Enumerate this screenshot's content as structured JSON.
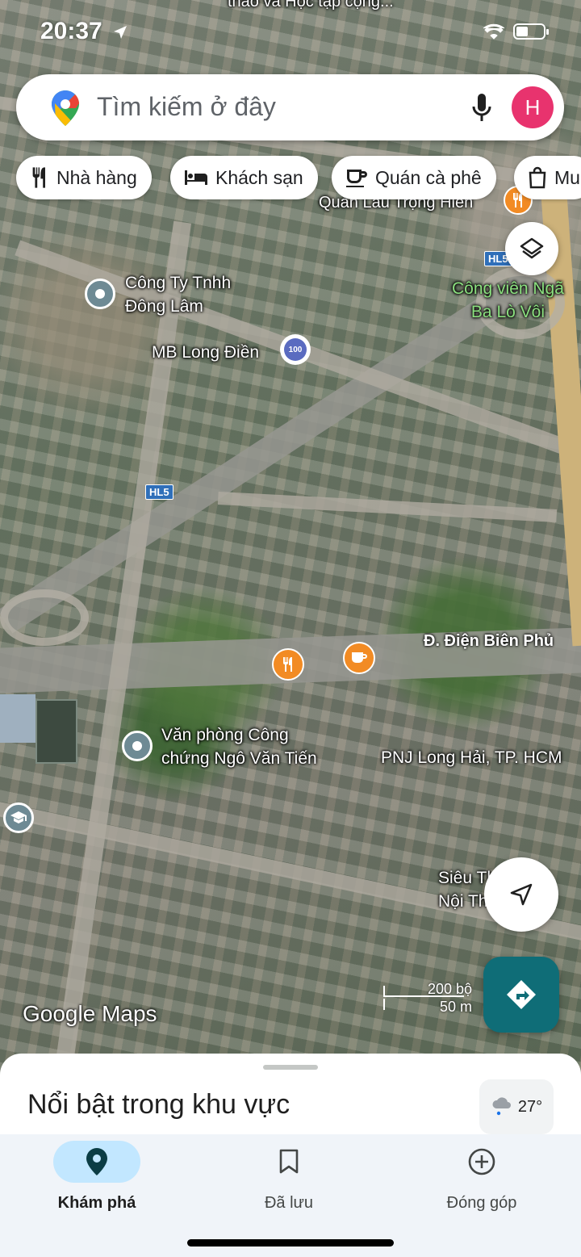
{
  "status_bar": {
    "time": "20:37"
  },
  "search": {
    "placeholder": "Tìm kiếm ở đây",
    "avatar_letter": "H"
  },
  "chips": [
    {
      "label": "Nhà hàng",
      "icon": "restaurant-icon"
    },
    {
      "label": "Khách sạn",
      "icon": "hotel-icon"
    },
    {
      "label": "Quán cà phê",
      "icon": "coffee-icon"
    },
    {
      "label": "Mu",
      "icon": "shopping-bag-icon"
    }
  ],
  "map": {
    "top_label": "thao và Học tập cộng...",
    "places": [
      {
        "name": "Quán Lẩu Trọng Hiền"
      },
      {
        "name": "Công Ty Tnhh\nĐông Lâm"
      },
      {
        "name": "Công viên Ngã\nBa Lò Vôi"
      },
      {
        "name": "MB Long Điền"
      },
      {
        "name": "Văn phòng Công\nchứng Ngô Văn Tiến"
      },
      {
        "name": "PNJ Long Hải, TP. HCM"
      },
      {
        "name": "Siêu Thị Máy\nNội Thất Lớn"
      }
    ],
    "bank_badge": "100",
    "road_shields": [
      "HL5",
      "HL5"
    ],
    "road_name": "Đ. Điện Biên Phủ",
    "scale": {
      "imperial": "200 bộ",
      "metric": "50 m"
    },
    "attribution": "Google Maps"
  },
  "sheet": {
    "title": "Nổi bật trong khu vực",
    "temperature": "27°"
  },
  "nav": [
    {
      "label": "Khám phá",
      "active": true
    },
    {
      "label": "Đã lưu",
      "active": false
    },
    {
      "label": "Đóng góp",
      "active": false
    }
  ],
  "colors": {
    "accent": "#0b5e6a",
    "active_pill": "#c2e7ff",
    "directions_fab": "#0f6d77",
    "avatar": "#e8336e"
  }
}
